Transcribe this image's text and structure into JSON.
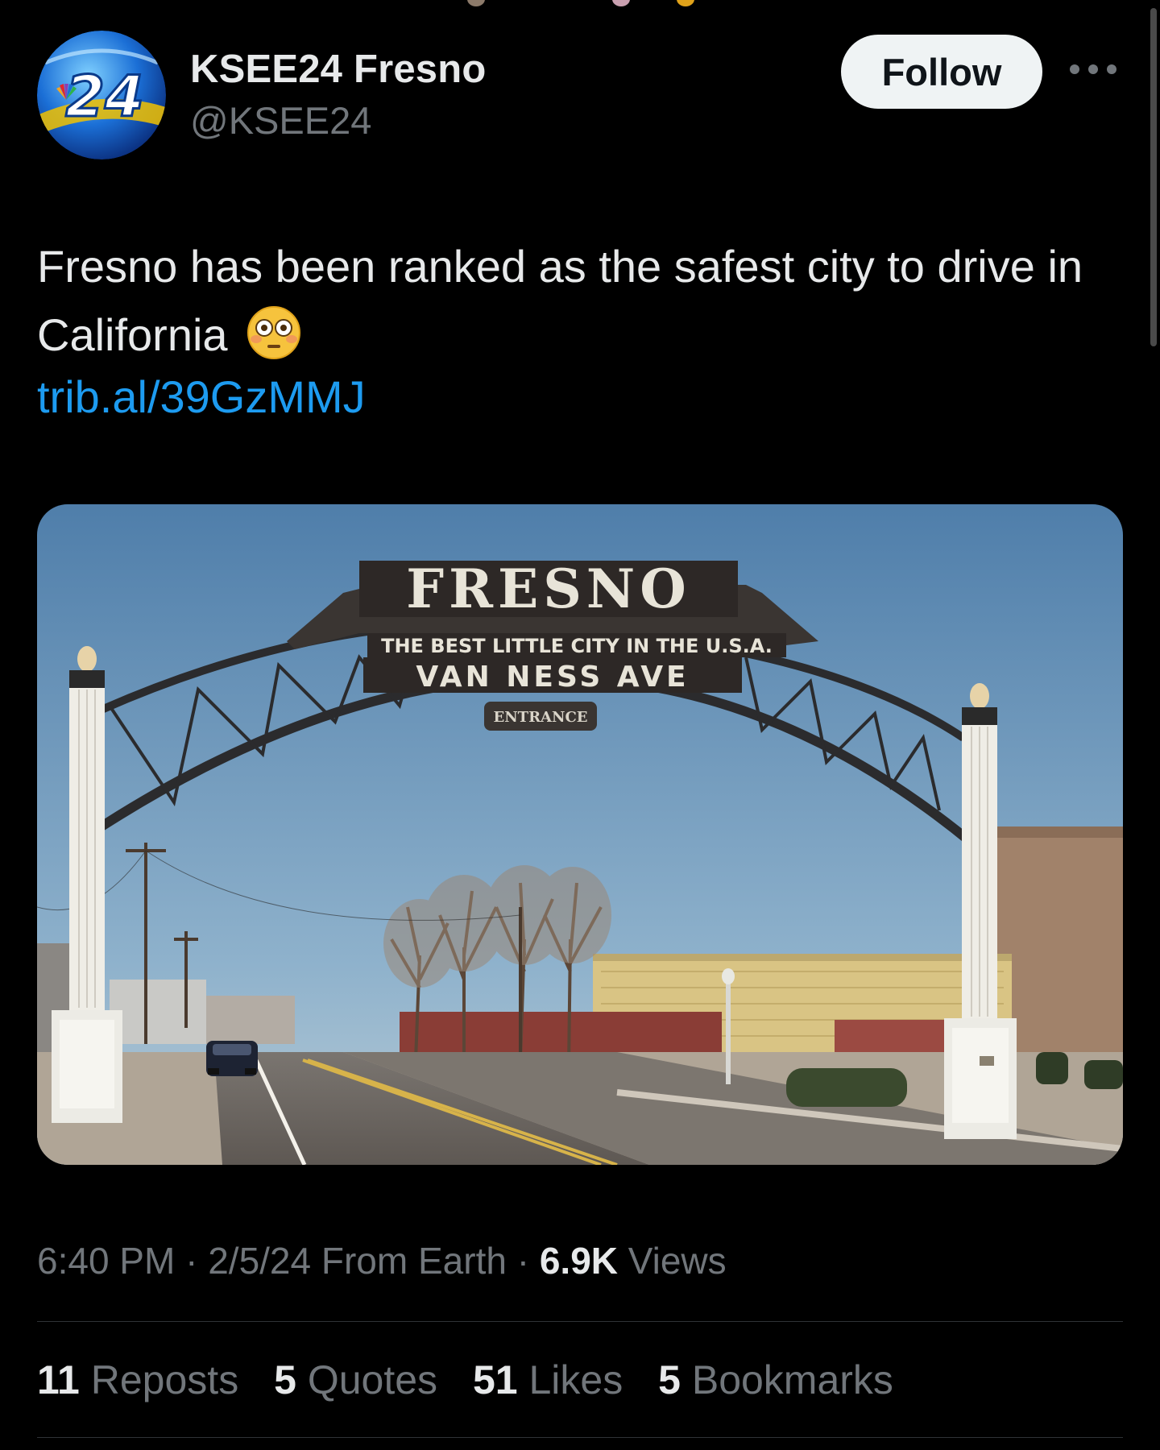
{
  "author": {
    "avatar_text": "24",
    "name": "KSEE24 Fresno",
    "handle": "@KSEE24"
  },
  "follow_label": "Follow",
  "tweet": {
    "text": "Fresno has been ranked as the safest city to drive in California",
    "emoji": "flushed-face",
    "link": "trib.al/39GzMMJ"
  },
  "photo": {
    "sign_title": "FRESNO",
    "sign_slogan": "THE BEST LITTLE CITY IN THE U.S.A.",
    "sign_street": "VAN NESS AVE",
    "sign_entrance": "ENTRANCE"
  },
  "meta": {
    "time": "6:40 PM",
    "date": "2/5/24",
    "source": "From Earth",
    "views_count": "6.9K",
    "views_label": "Views"
  },
  "stats": {
    "reposts_count": "11",
    "reposts_label": "Reposts",
    "quotes_count": "5",
    "quotes_label": "Quotes",
    "likes_count": "51",
    "likes_label": "Likes",
    "bookmarks_count": "5",
    "bookmarks_label": "Bookmarks"
  },
  "colors": {
    "background": "#000000",
    "link": "#1d9bf0",
    "secondary_text": "#71767b",
    "follow_button": "#eff3f4"
  }
}
